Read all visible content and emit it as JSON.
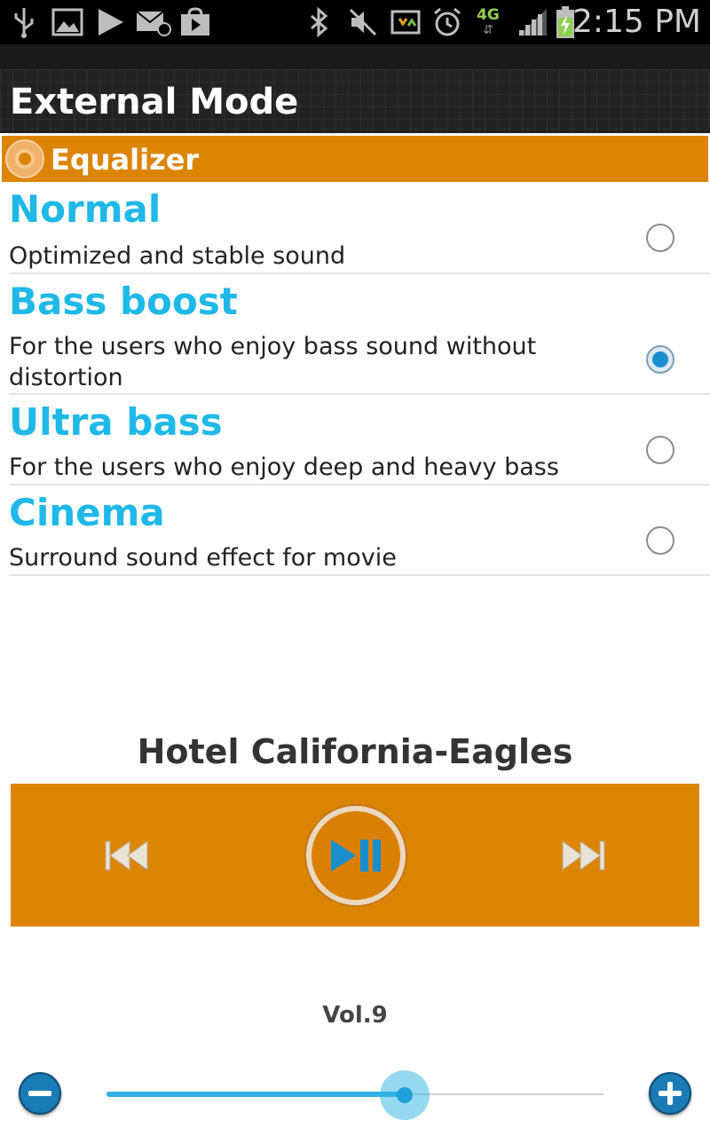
{
  "status_bar": {
    "time": "2:15 PM",
    "network": "4G",
    "icons": [
      "usb-icon",
      "gallery-icon",
      "play-store-icon",
      "email-icon",
      "shop-bag-icon",
      "bluetooth-icon",
      "mute-icon",
      "sync-icon",
      "alarm-icon",
      "network-4g-icon",
      "signal-icon",
      "battery-charging-icon"
    ]
  },
  "header": {
    "title": "External Mode"
  },
  "equalizer": {
    "section_title": "Equalizer",
    "options": [
      {
        "title": "Normal",
        "description": "Optimized and stable sound",
        "selected": false
      },
      {
        "title": "Bass boost",
        "description": "For the users who enjoy bass sound without distortion",
        "selected": true
      },
      {
        "title": "Ultra bass",
        "description": "For the users who enjoy deep and heavy bass",
        "selected": false
      },
      {
        "title": "Cinema",
        "description": "Surround sound effect for movie",
        "selected": false
      }
    ]
  },
  "player": {
    "track": "Hotel California-Eagles",
    "controls": [
      "previous-icon",
      "play-pause-icon",
      "next-icon"
    ],
    "accent_color": "#dc8505"
  },
  "volume": {
    "label": "Vol.9",
    "level_fraction": 0.6
  },
  "colors": {
    "accent": "#dc8505",
    "title_blue": "#1fb8e8",
    "slider": "#2fb2e3"
  }
}
